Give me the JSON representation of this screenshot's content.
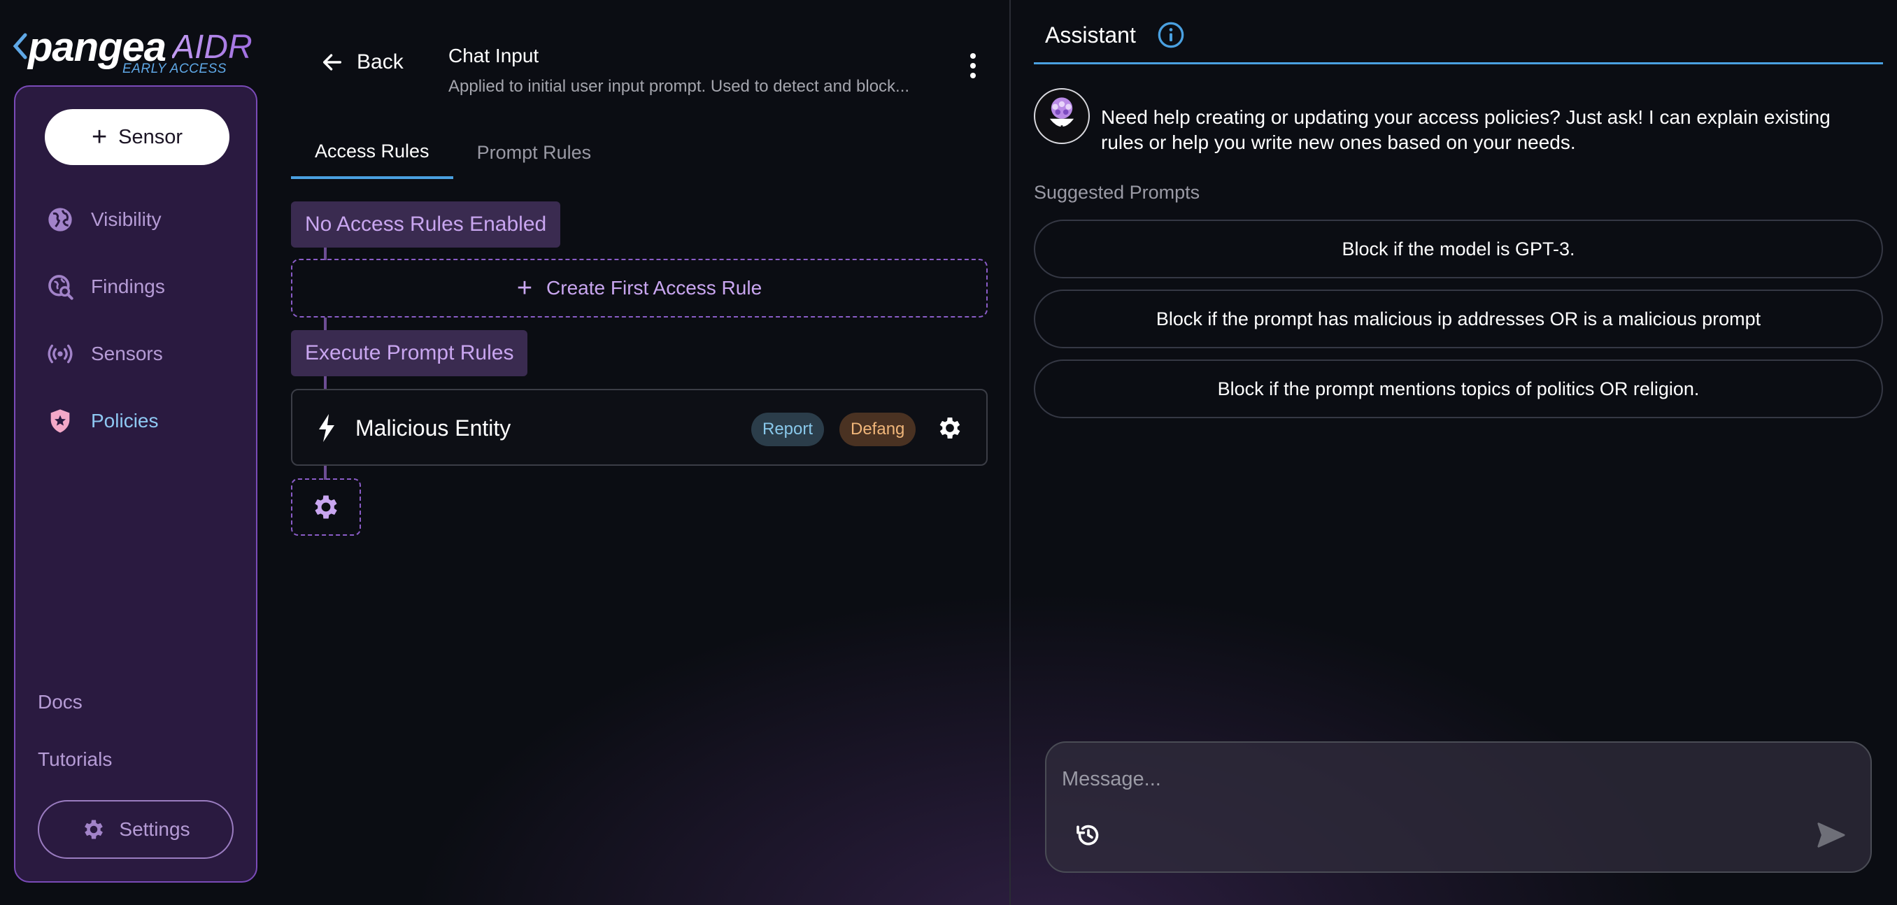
{
  "logo": {
    "brand": "pangea",
    "product": "AIDR",
    "badge": "EARLY ACCESS"
  },
  "sidebar": {
    "primary_button": {
      "icon": "plus-icon",
      "label": "Sensor"
    },
    "items": [
      {
        "label": "Visibility",
        "icon": "globe-icon",
        "active": false
      },
      {
        "label": "Findings",
        "icon": "magnifier-globe-icon",
        "active": false
      },
      {
        "label": "Sensors",
        "icon": "broadcast-icon",
        "active": false
      },
      {
        "label": "Policies",
        "icon": "shield-star-icon",
        "active": true
      }
    ],
    "docs_label": "Docs",
    "tutorials_label": "Tutorials",
    "settings_label": "Settings"
  },
  "main": {
    "back_label": "Back",
    "title": "Chat Input",
    "subtitle": "Applied to initial user input prompt. Used to detect and block...",
    "tabs": [
      {
        "label": "Access Rules",
        "active": true
      },
      {
        "label": "Prompt Rules",
        "active": false
      }
    ],
    "access_status": "No Access Rules Enabled",
    "create_rule_label": "Create First Access Rule",
    "execute_label": "Execute Prompt Rules",
    "rule": {
      "name": "Malicious Entity",
      "badges": [
        {
          "label": "Report",
          "color": "#89c8ea"
        },
        {
          "label": "Defang",
          "color": "#f0b67a"
        }
      ]
    }
  },
  "assistant": {
    "title": "Assistant",
    "message": "Need help creating or updating your access policies? Just ask! I can explain existing rules or help you write new ones based on your needs.",
    "suggested_title": "Suggested Prompts",
    "suggestions": [
      "Block if the model is GPT-3.",
      "Block if the prompt has malicious ip addresses OR is a malicious prompt",
      "Block if the prompt mentions topics of politics OR religion."
    ],
    "input_placeholder": "Message..."
  },
  "colors": {
    "accent": "#4aa0e0",
    "sidebar_bg": "#2a1a40",
    "sidebar_border": "#7a4bb8",
    "purple_text": "#c9a6f0",
    "background": "#0b0d13"
  }
}
